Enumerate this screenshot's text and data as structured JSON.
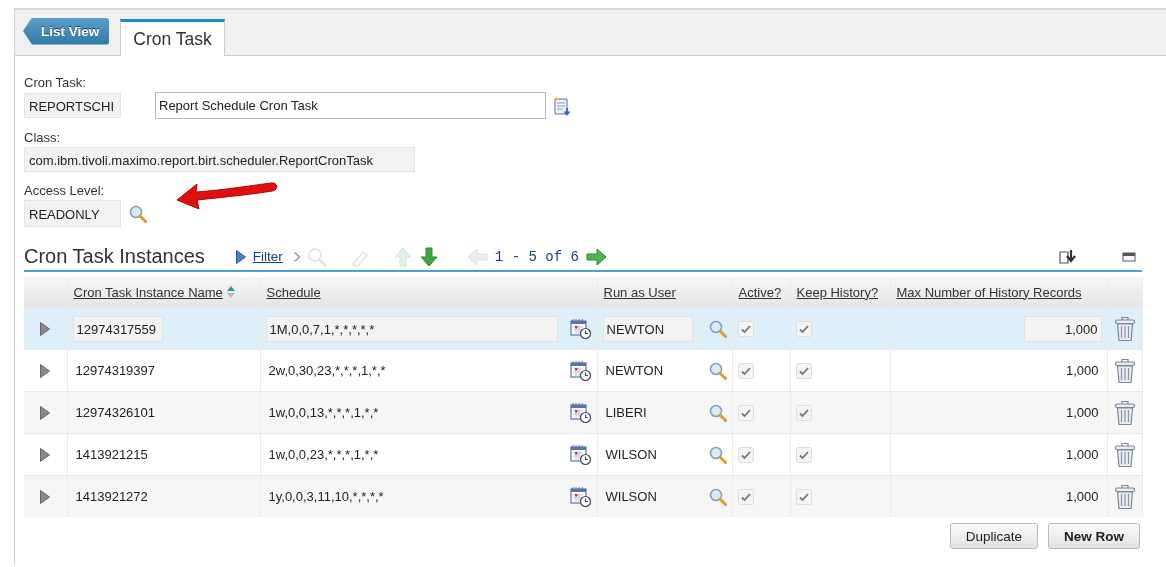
{
  "tabs": [
    {
      "label": "List View",
      "kind": "back",
      "selected": false
    },
    {
      "label": "Cron Task",
      "kind": "tab",
      "selected": true
    }
  ],
  "form": {
    "cron_task": {
      "label": "Cron Task:",
      "value": "REPORTSCHI",
      "description": "Report Schedule Cron Task"
    },
    "class": {
      "label": "Class:",
      "value": "com.ibm.tivoli.maximo.report.birt.scheduler.ReportCronTask"
    },
    "access_level": {
      "label": "Access Level:",
      "value": "READONLY"
    }
  },
  "instances": {
    "title": "Cron Task Instances",
    "filter": "Filter",
    "page_info": "1 - 5 of 6",
    "columns": [
      {
        "label": "Cron Task Instance Name",
        "sorted": true
      },
      {
        "label": "Schedule",
        "sorted": false
      },
      {
        "label": "Run as User",
        "sorted": false
      },
      {
        "label": "Active?",
        "sorted": false
      },
      {
        "label": "Keep History?",
        "sorted": false
      },
      {
        "label": "Max Number of History Records",
        "sorted": false
      }
    ],
    "rows": [
      {
        "selected": true,
        "name": "12974317559",
        "schedule": "1M,0,0,7,1,*,*,*,*,*",
        "user": "NEWTON",
        "active": true,
        "keep_history": true,
        "max_records": "1,000"
      },
      {
        "selected": false,
        "name": "12974319397",
        "schedule": "2w,0,30,23,*,*,*,1,*,*",
        "user": "NEWTON",
        "active": true,
        "keep_history": true,
        "max_records": "1,000"
      },
      {
        "selected": false,
        "name": "12974326101",
        "schedule": "1w,0,0,13,*,*,*,1,*,*",
        "user": "LIBERI",
        "active": true,
        "keep_history": true,
        "max_records": "1,000"
      },
      {
        "selected": false,
        "name": "1413921215",
        "schedule": "1w,0,0,23,*,*,*,1,*,*",
        "user": "WILSON",
        "active": true,
        "keep_history": true,
        "max_records": "1,000"
      },
      {
        "selected": false,
        "name": "1413921272",
        "schedule": "1y,0,0,3,11,10,*,*,*,*",
        "user": "WILSON",
        "active": true,
        "keep_history": true,
        "max_records": "1,000"
      }
    ],
    "buttons": [
      "Duplicate",
      "New Row"
    ]
  }
}
